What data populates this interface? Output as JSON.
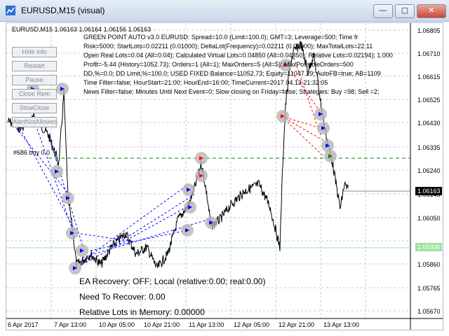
{
  "window": {
    "title": "EURUSD,M15 (visual)",
    "minimize_label": "—",
    "restore_label": "▢",
    "close_label": "✕"
  },
  "chart": {
    "symbol_line": "EURUSD,M15  1.06163 1.06164 1.06156 1.06163",
    "info_lines": [
      "GREEN POINT AUTO v3.0     EURUSD:    Spread=10.0 (Limit=100.0);    GMT=3;    Leverage=500;    Time fr",
      "Risk=5000;    StartLots=0.02211 (0.01000);    DeltaLot(Frequency)=0.02211 (0.01000);    MaxTotalLots=22.11",
      "Open Real Lots=0.04 (All=0.04);    Calculated Virtual Lots=0.04850 (All=0.04850);    Relative Lots=0.02194);    1.000",
      "Profit=-5.44 (History=1052.73);    Orders=1 (All=1);    MaxOrders=5 (All=5);    MaxPossibleOrders=500",
      "DD,%=0.0; DD Limit,%=100.0;    USED FIXED Balance=11052.73; Equity=11047.29; AutoFB=true; AB=1109",
      "Time Filter=false; HourStart=21:00; HourEnd=16:00; TimeCurrent=2017.04.13 21:32:05",
      "News Filter=false;  Minutes Until Next Event=0;    Slow closing on Friday=false;  Strategies: Buy =98; Sell =2;"
    ],
    "buttons": [
      "Hide info",
      "Restart",
      "Pause",
      "Close Rem",
      "SlowClose",
      "AlertNotAllowed"
    ],
    "trade_label": "#686 buy 0.0",
    "bottom_lines": [
      "EA Recovery: OFF; Local (relative:0.00; real:0.00)",
      "Need To Recover: 0.00",
      "Relative Lots in Memory: 0.00000"
    ],
    "price_ticks": [
      "1.06805",
      "1.06710",
      "1.06615",
      "1.06525",
      "1.06430",
      "1.06335",
      "1.06240",
      "1.06145",
      "1.06050",
      "1.05955",
      "1.05860",
      "1.05765",
      "1.05670"
    ],
    "current_price": "1.06163",
    "green_level_price": "1.05936",
    "time_ticks": [
      "6 Apr 2017",
      "7 Apr 13:00",
      "10 Apr 05:00",
      "10 Apr 21:00",
      "11 Apr 13:00",
      "12 Apr 05:00",
      "12 Apr 21:00",
      "13 Apr 13:00"
    ]
  },
  "colors": {
    "price_line": "#000000",
    "dashed_blue": "#0000ff",
    "dashed_red": "#ff0000",
    "dashed_green": "#008000",
    "green_level": "#9be39b",
    "marker_circle": "#b5b5b5",
    "grid": "#c8c8c8"
  }
}
